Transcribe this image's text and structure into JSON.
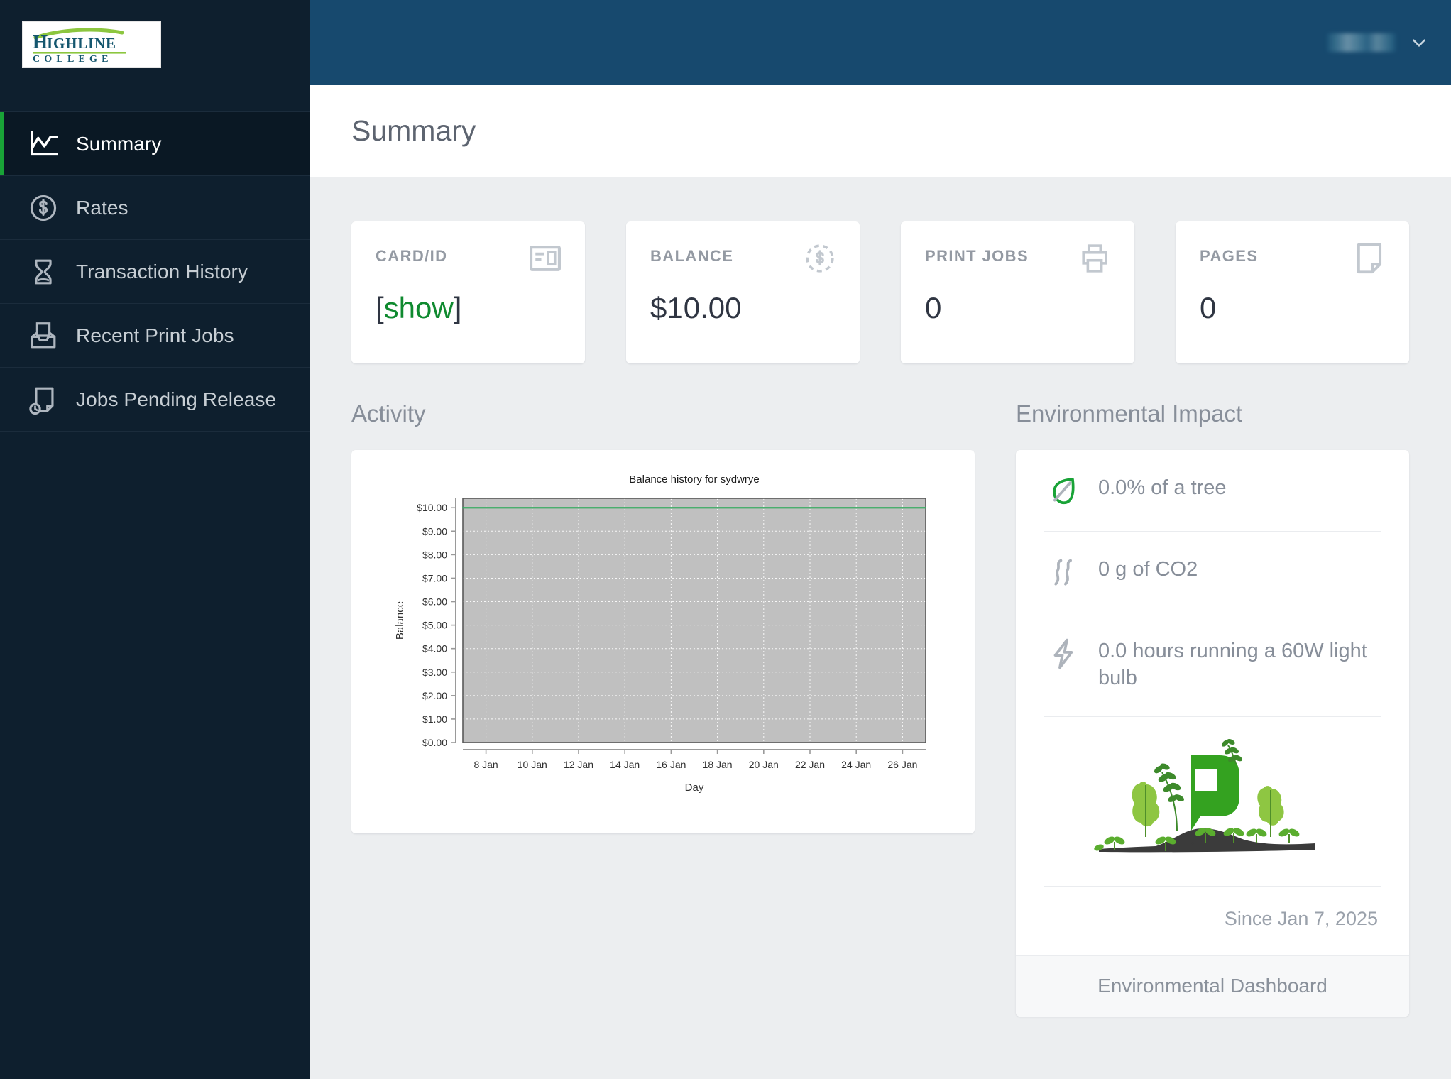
{
  "brand": {
    "logo_line1": "HIGHLINE",
    "logo_line2": "COLLEGE",
    "logo_text_color": "#14566e",
    "logo_accent_color": "#8cc63f"
  },
  "topbar": {
    "background_color": "#17496e",
    "user_name": "",
    "caret_icon": "chevron-down-icon"
  },
  "sidebar": {
    "background_color": "#0e1f2e",
    "active_accent_color": "#19a337",
    "items": [
      {
        "label": "Summary",
        "icon": "line-chart-icon",
        "active": true
      },
      {
        "label": "Rates",
        "icon": "dollar-circle-icon",
        "active": false
      },
      {
        "label": "Transaction History",
        "icon": "hourglass-icon",
        "active": false
      },
      {
        "label": "Recent Print Jobs",
        "icon": "printer-tray-icon",
        "active": false
      },
      {
        "label": "Jobs Pending Release",
        "icon": "document-clock-icon",
        "active": false
      }
    ]
  },
  "page": {
    "title": "Summary"
  },
  "stat_cards": [
    {
      "label": "CARD/ID",
      "icon": "id-card-icon",
      "value_prefix": "[",
      "value_link": "show",
      "value_suffix": "]",
      "link_color": "#0f8a2f"
    },
    {
      "label": "BALANCE",
      "icon": "dollar-dashed-circle-icon",
      "value": "$10.00"
    },
    {
      "label": "PRINT JOBS",
      "icon": "printer-icon",
      "value": "0"
    },
    {
      "label": "PAGES",
      "icon": "page-icon",
      "value": "0"
    }
  ],
  "activity": {
    "title": "Activity"
  },
  "environment": {
    "title": "Environmental Impact",
    "rows": [
      {
        "icon": "leaf-icon",
        "text": "0.0% of a tree",
        "icon_color": "#19a337"
      },
      {
        "icon": "smoke-icon",
        "text": "0 g of CO2",
        "icon_color": "#adb3bb"
      },
      {
        "icon": "lightning-bolt-icon",
        "text": "0.0 hours running a 60W light bulb",
        "icon_color": "#adb3bb"
      }
    ],
    "illustration": "papercut-plants-logo",
    "since": "Since Jan 7, 2025",
    "footer_link": "Environmental Dashboard"
  },
  "chart_data": {
    "type": "line",
    "title": "Balance history for sydwrye",
    "xlabel": "Day",
    "ylabel": "Balance",
    "ylim": [
      0,
      10.4
    ],
    "ytick_labels": [
      "$0.00",
      "$1.00",
      "$2.00",
      "$3.00",
      "$4.00",
      "$5.00",
      "$6.00",
      "$7.00",
      "$8.00",
      "$9.00",
      "$10.00"
    ],
    "ytick_values": [
      0,
      1,
      2,
      3,
      4,
      5,
      6,
      7,
      8,
      9,
      10
    ],
    "xtick_labels": [
      "8 Jan",
      "10 Jan",
      "12 Jan",
      "14 Jan",
      "16 Jan",
      "18 Jan",
      "20 Jan",
      "22 Jan",
      "24 Jan",
      "26 Jan"
    ],
    "xtick_values": [
      8,
      10,
      12,
      14,
      16,
      18,
      20,
      22,
      24,
      26
    ],
    "xlim": [
      7,
      27
    ],
    "grid": true,
    "legend": "none",
    "plot_bg_color": "#c0c0c0",
    "gridline_color": "#ffffff",
    "series": [
      {
        "name": "Balance",
        "color": "#3aab63",
        "x": [
          7,
          8,
          9,
          10,
          11,
          12,
          13,
          14,
          15,
          16,
          17,
          18,
          19,
          20,
          21,
          22,
          23,
          24,
          25,
          26,
          27
        ],
        "values": [
          10,
          10,
          10,
          10,
          10,
          10,
          10,
          10,
          10,
          10,
          10,
          10,
          10,
          10,
          10,
          10,
          10,
          10,
          10,
          10,
          10
        ]
      }
    ]
  }
}
